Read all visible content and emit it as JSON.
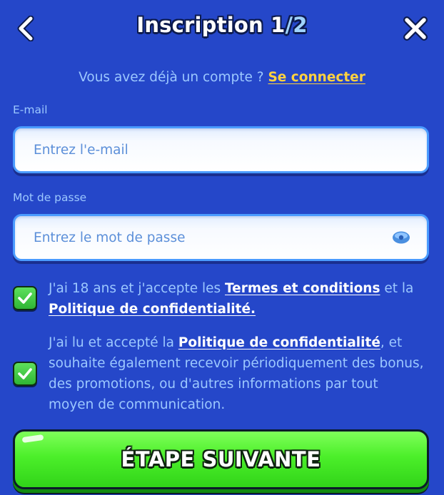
{
  "header": {
    "title": "Inscription 1",
    "title_total": "/2",
    "back_icon": "chevron-left-icon",
    "close_icon": "close-icon"
  },
  "login_prompt": {
    "text": "Vous avez déjà un compte ? ",
    "link": "Se connecter"
  },
  "email": {
    "label": "E-mail",
    "placeholder": "Entrez l'e-mail",
    "value": ""
  },
  "password": {
    "label": "Mot de passe",
    "placeholder": "Entrez le mot de passe",
    "value": "",
    "toggle_icon": "eye-icon"
  },
  "consents": [
    {
      "checked": true,
      "text_before": "J'ai 18 ans et j'accepte les ",
      "link1": "Termes et conditions",
      "text_middle": " et la ",
      "link2": "Politique de confidentialité."
    },
    {
      "checked": true,
      "text_before": "J'ai lu et accepté la ",
      "link1": "Politique de confidentialité",
      "text_after": ", et souhaite également recevoir périodiquement des bonus, des promotions, ou d'autres informations par tout moyen de communication."
    }
  ],
  "next_button": {
    "label": "ÉTAPE SUIVANTE"
  },
  "colors": {
    "background": "#2547C9",
    "muted_text": "#9CC8FF",
    "link_yellow": "#FFD23F",
    "input_border": "#4A9BFF",
    "check_green": "#2FB535",
    "button_green": "#4CEF2A"
  }
}
